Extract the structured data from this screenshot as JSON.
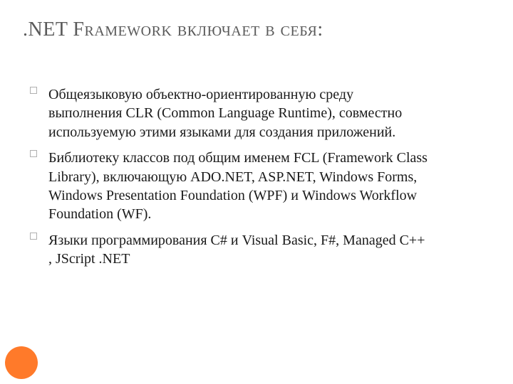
{
  "title": ".NET Framework включает в себя:",
  "items": [
    "Общеязыковую объектно-ориентированную среду выполнения CLR (Common Language Runtime), совместно используемую этими языками для создания приложений.",
    "Библиотеку классов под общим именем FCL (Framework Class Library), включающую ADO.NET, ASP.NET, Windows Forms, Windows Presentation Foundation (WPF) и Windows Workflow Foundation (WF).",
    "Языки программирования C# и Visual Basic, F#, Managed C++ , JScript .NET"
  ]
}
